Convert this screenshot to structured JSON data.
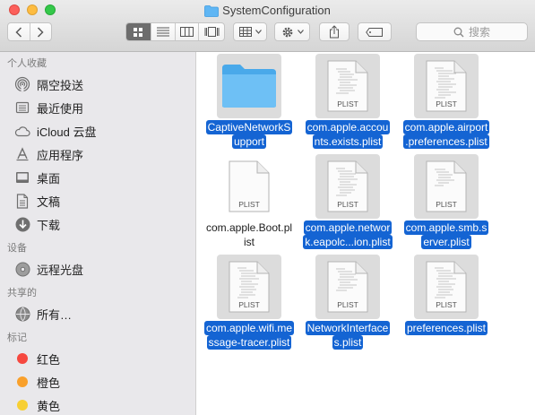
{
  "window": {
    "title": "SystemConfiguration"
  },
  "toolbar": {
    "search_placeholder": "搜索"
  },
  "sidebar": {
    "sections": [
      {
        "title": "个人收藏",
        "items": [
          {
            "label": "隔空投送",
            "icon": "airdrop-icon"
          },
          {
            "label": "最近使用",
            "icon": "recents-icon"
          },
          {
            "label": "iCloud 云盘",
            "icon": "icloud-icon"
          },
          {
            "label": "应用程序",
            "icon": "applications-icon"
          },
          {
            "label": "桌面",
            "icon": "desktop-icon"
          },
          {
            "label": "文稿",
            "icon": "documents-icon"
          },
          {
            "label": "下载",
            "icon": "downloads-icon"
          }
        ]
      },
      {
        "title": "设备",
        "items": [
          {
            "label": "远程光盘",
            "icon": "remote-disc-icon"
          }
        ]
      },
      {
        "title": "共享的",
        "items": [
          {
            "label": "所有…",
            "icon": "network-icon"
          }
        ]
      },
      {
        "title": "标记",
        "items": [
          {
            "label": "红色",
            "color": "#f6483f"
          },
          {
            "label": "橙色",
            "color": "#f9a02b"
          },
          {
            "label": "黄色",
            "color": "#f7cf33"
          }
        ]
      }
    ]
  },
  "files": {
    "plist_badge": "PLIST",
    "items": [
      {
        "name1": "CaptiveNetworkS",
        "name2": "upport",
        "kind": "folder",
        "selected": true
      },
      {
        "name1": "com.apple.accou",
        "name2": "nts.exists.plist",
        "kind": "plist",
        "selected": true
      },
      {
        "name1": "com.apple.airport",
        "name2": ".preferences.plist",
        "kind": "plist",
        "selected": true
      },
      {
        "name1": "com.apple.Boot.pl",
        "name2": "ist",
        "kind": "plist-blank",
        "selected": false
      },
      {
        "name1": "com.apple.networ",
        "name2": "k.eapolc...ion.plist",
        "kind": "plist",
        "selected": true
      },
      {
        "name1": "com.apple.smb.s",
        "name2": "erver.plist",
        "kind": "plist",
        "selected": true
      },
      {
        "name1": "com.apple.wifi.me",
        "name2": "ssage-tracer.plist",
        "kind": "plist",
        "selected": true
      },
      {
        "name1": "NetworkInterface",
        "name2": "s.plist",
        "kind": "plist",
        "selected": true
      },
      {
        "name1": "preferences.plist",
        "name2": "",
        "kind": "plist",
        "selected": true
      }
    ]
  }
}
